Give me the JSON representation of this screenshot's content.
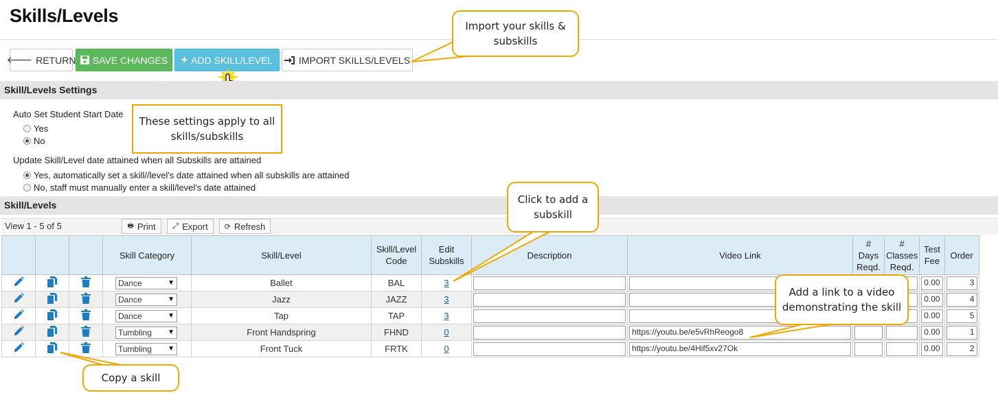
{
  "page": {
    "title": "Skills/Levels"
  },
  "toolbar": {
    "return_label": "RETURN",
    "save_label": "SAVE CHANGES",
    "add_label": "ADD SKILL/LEVEL",
    "import_label": "IMPORT SKILLS/LEVELS"
  },
  "settings": {
    "section_title": "Skill/Levels Settings",
    "auto_start": {
      "label": "Auto Set Student Start Date",
      "options": [
        "Yes",
        "No"
      ],
      "selected": "No"
    },
    "update_attained": {
      "label": "Update Skill/Level date attained when all Subskills are attained",
      "options": [
        "Yes, automatically set a skill//level's date attained when all subskills are attained",
        "No, staff must manually enter a skill/level's date attained"
      ],
      "selected": "Yes, automatically set a skill//level's date attained when all subskills are attained"
    }
  },
  "grid": {
    "section_title": "Skill/Levels",
    "view_count": "View 1 - 5 of 5",
    "print_label": "Print",
    "export_label": "Export",
    "refresh_label": "Refresh",
    "columns": {
      "category": "Skill Category",
      "skill": "Skill/Level",
      "code_1": "Skill/Level",
      "code_2": "Code",
      "edit_1": "Edit",
      "edit_2": "Subskills",
      "description": "Description",
      "video": "Video Link",
      "days_1": "#",
      "days_2": "Days",
      "days_3": "Reqd.",
      "classes_1": "#",
      "classes_2": "Classes",
      "classes_3": "Reqd.",
      "fee_1": "Test",
      "fee_2": "Fee",
      "order": "Order"
    },
    "rows": [
      {
        "category": "Dance",
        "skill": "Ballet",
        "code": "BAL",
        "subskills": "3",
        "description": "",
        "video": "",
        "days": "",
        "classes": "",
        "fee": "0.00",
        "order": "3"
      },
      {
        "category": "Dance",
        "skill": "Jazz",
        "code": "JAZZ",
        "subskills": "3",
        "description": "",
        "video": "",
        "days": "",
        "classes": "",
        "fee": "0.00",
        "order": "4"
      },
      {
        "category": "Dance",
        "skill": "Tap",
        "code": "TAP",
        "subskills": "3",
        "description": "",
        "video": "",
        "days": "",
        "classes": "",
        "fee": "0.00",
        "order": "5"
      },
      {
        "category": "Tumbling",
        "skill": "Front Handspring",
        "code": "FHND",
        "subskills": "0",
        "description": "",
        "video": "https://youtu.be/e5vRhReogo8",
        "days": "",
        "classes": "",
        "fee": "0.00",
        "order": "1"
      },
      {
        "category": "Tumbling",
        "skill": "Front Tuck",
        "code": "FRTK",
        "subskills": "0",
        "description": "",
        "video": "https://youtu.be/4Hif5xv27Ok",
        "days": "",
        "classes": "",
        "fee": "0.00",
        "order": "2"
      }
    ]
  },
  "callouts": {
    "import": "Import your skills & subskills",
    "settings": "These settings apply to all skills/subskills",
    "subskill": "Click to add a subskill",
    "video": "Add a link to a video demonstrating the skill",
    "copy": "Copy a skill"
  },
  "colors": {
    "save": "#5cb85c",
    "add": "#5bc0de",
    "callout_border": "#f0a800",
    "header_bg": "#dcecf7",
    "icon": "#1c7fc5"
  }
}
